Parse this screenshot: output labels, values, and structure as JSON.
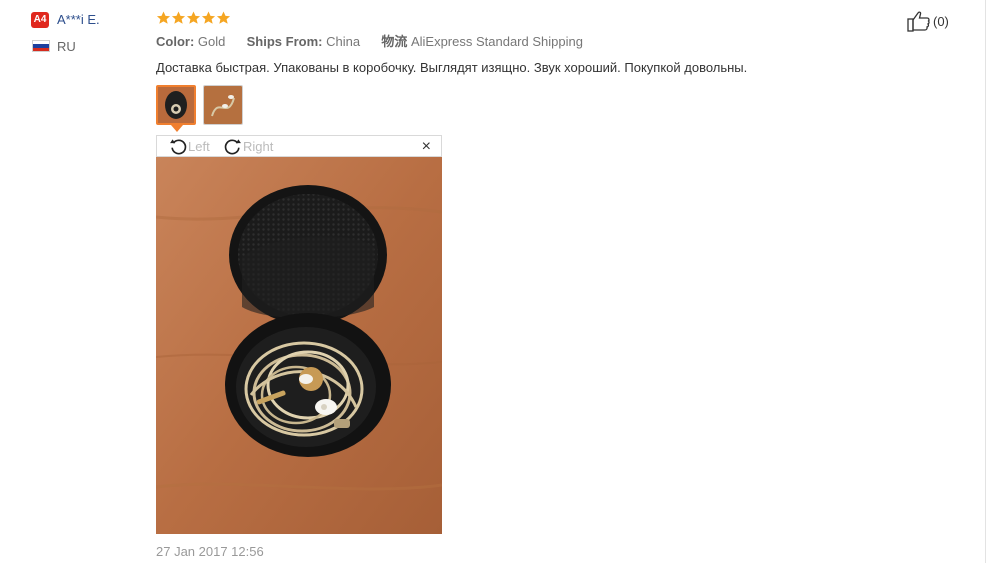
{
  "buyer": {
    "badge": "A4",
    "name": "A***i E.",
    "country": "RU",
    "flag_colors": [
      "#ffffff",
      "#1c3f9e",
      "#d52b1e"
    ]
  },
  "review": {
    "rating": 5,
    "color_label": "Color:",
    "color_value": "Gold",
    "ships_label": "Ships From:",
    "ships_value": "China",
    "shipping_icon_text": "物流",
    "shipping_method": "AliExpress Standard Shipping",
    "text": "Доставка быстрая. Упакованы в коробочку. Выглядят изящно. Звук хороший. Покупкой довольны.",
    "date": "27 Jan 2017 12:56"
  },
  "viewer": {
    "rotate_left_label": "Left",
    "rotate_right_label": "Right",
    "close_glyph": "×"
  },
  "helpful": {
    "count": "(0)"
  },
  "colors": {
    "star": "#f5a623",
    "accent": "#f07f2f",
    "badge": "#e0281e",
    "name": "#2d4e8c"
  }
}
